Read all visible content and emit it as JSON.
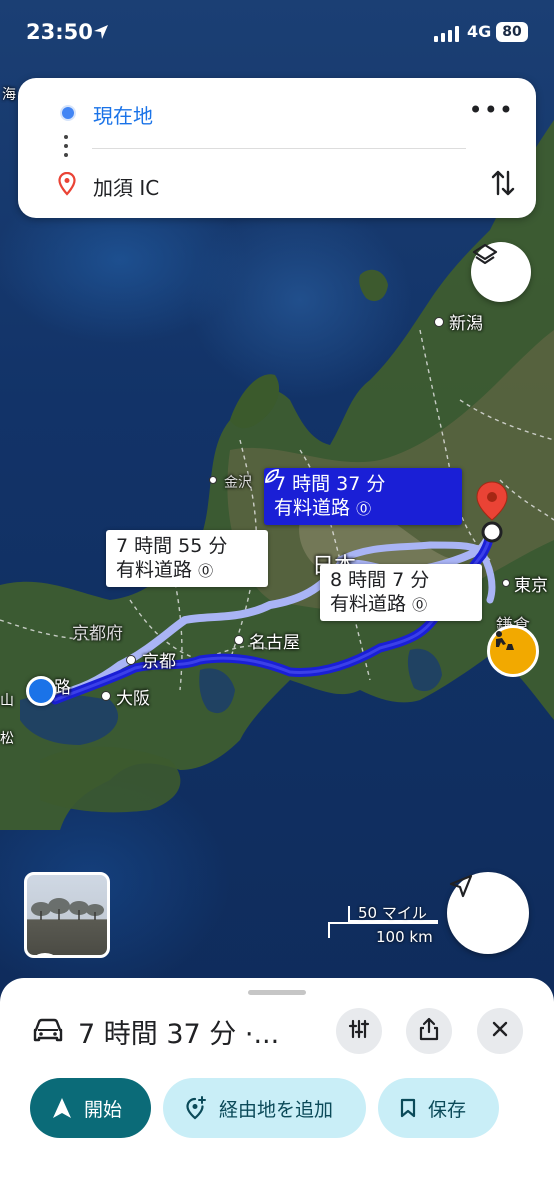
{
  "status_bar": {
    "time": "23:50",
    "network": "4G",
    "battery": "80"
  },
  "route_card": {
    "origin": "現在地",
    "destination": "加須 IC"
  },
  "map_labels": {
    "niigata": "新潟",
    "kanazawa": "金沢",
    "kyotofu": "京都府",
    "kyoto": "京都",
    "osaka": "大阪",
    "nagoya": "名古屋",
    "tokyo": "東京",
    "kamakura": "鎌倉",
    "sea": "海",
    "left_edge_1": "山",
    "left_edge_2": "路",
    "left_edge_3": "松",
    "japan_partial": "日本"
  },
  "routes": [
    {
      "time": "7 時間 37 分",
      "tag": "有料道路",
      "selected": true
    },
    {
      "time": "7 時間 55 分",
      "tag": "有料道路",
      "selected": false
    },
    {
      "time": "8 時間 7 分",
      "tag": "有料道路",
      "selected": false
    }
  ],
  "scale": {
    "miles": "50 マイル",
    "km": "100 km"
  },
  "sheet": {
    "summary": "7 時間 37 分 ·...",
    "start_label": "開始",
    "waypoint_label": "経由地を追加",
    "save_label": "保存"
  },
  "colors": {
    "route_primary": "#1a1fd6",
    "route_alt": "#a9b4f5",
    "start_button": "#0b6b78",
    "secondary_button": "#c9eef7",
    "destination_pin": "#ea4335"
  }
}
